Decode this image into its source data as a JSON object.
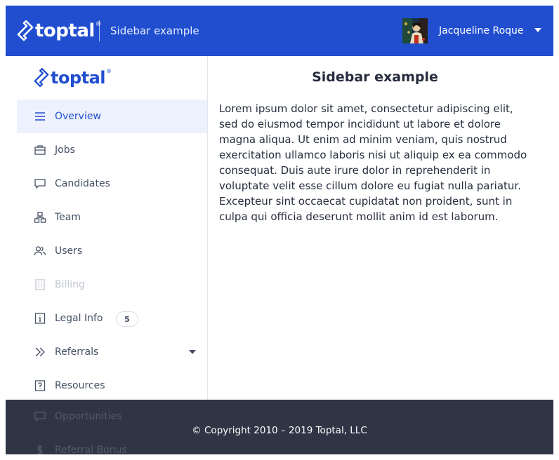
{
  "header": {
    "brand": "toptal",
    "title": "Sidebar example",
    "user_name": "Jacqueline Roque"
  },
  "sidebar": {
    "brand": "toptal",
    "items": [
      {
        "label": "Overview",
        "icon": "list-icon"
      },
      {
        "label": "Jobs",
        "icon": "briefcase-icon"
      },
      {
        "label": "Candidates",
        "icon": "chat-icon"
      },
      {
        "label": "Team",
        "icon": "hierarchy-icon"
      },
      {
        "label": "Users",
        "icon": "users-icon"
      },
      {
        "label": "Billing",
        "icon": "invoice-icon"
      },
      {
        "label": "Legal Info",
        "icon": "info-icon",
        "badge": "5"
      },
      {
        "label": "Referrals",
        "icon": "double-chevron-icon"
      },
      {
        "label": "Resources",
        "icon": "help-icon"
      },
      {
        "label": "Opportunities",
        "icon": "chat-icon"
      },
      {
        "label": "Referral Bonus",
        "icon": "dollar-icon"
      }
    ]
  },
  "main": {
    "title": "Sidebar example",
    "body": "Lorem ipsum dolor sit amet, consectetur adipiscing elit, sed do eiusmod tempor incididunt ut labore et dolore magna aliqua. Ut enim ad minim veniam, quis nostrud exercitation ullamco laboris nisi ut aliquip ex ea commodo consequat. Duis aute irure dolor in reprehenderit in voluptate velit esse cillum dolore eu fugiat nulla pariatur. Excepteur sint occaecat cupidatat non proident, sunt in culpa qui officia deserunt mollit anim id est laborum."
  },
  "footer": {
    "copyright": "© Copyright 2010 – 2019 Toptal, LLC"
  },
  "colors": {
    "brand_blue": "#204ecf",
    "footer_dark": "#262d3d",
    "active_bg": "#edf1fd"
  }
}
